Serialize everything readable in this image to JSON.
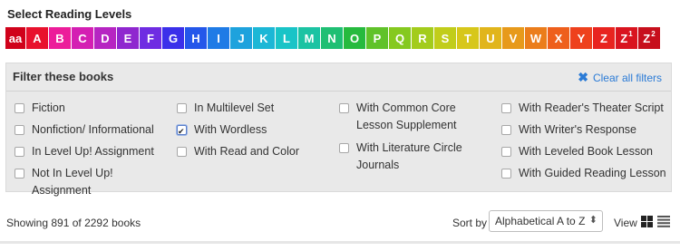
{
  "levels": {
    "title": "Select Reading Levels",
    "items": [
      {
        "label": "aa",
        "color": "#d0021b"
      },
      {
        "label": "A",
        "color": "#e8112d"
      },
      {
        "label": "B",
        "color": "#ec1d9a"
      },
      {
        "label": "C",
        "color": "#d41fb3"
      },
      {
        "label": "D",
        "color": "#b625c2"
      },
      {
        "label": "E",
        "color": "#8f27cf"
      },
      {
        "label": "F",
        "color": "#6f2ce2"
      },
      {
        "label": "G",
        "color": "#3b30ea"
      },
      {
        "label": "H",
        "color": "#2457ea"
      },
      {
        "label": "I",
        "color": "#1f7be6"
      },
      {
        "label": "J",
        "color": "#1ea2dd"
      },
      {
        "label": "K",
        "color": "#1cb7d6"
      },
      {
        "label": "L",
        "color": "#19c4c7"
      },
      {
        "label": "M",
        "color": "#1cc3a3"
      },
      {
        "label": "N",
        "color": "#1fbf73"
      },
      {
        "label": "O",
        "color": "#26ba3e"
      },
      {
        "label": "P",
        "color": "#60c22a"
      },
      {
        "label": "Q",
        "color": "#85c91f"
      },
      {
        "label": "R",
        "color": "#a3cc1c"
      },
      {
        "label": "S",
        "color": "#c1cd1a"
      },
      {
        "label": "T",
        "color": "#d7c71a"
      },
      {
        "label": "U",
        "color": "#e1b51b"
      },
      {
        "label": "V",
        "color": "#e79a1b"
      },
      {
        "label": "W",
        "color": "#eb7d1b"
      },
      {
        "label": "X",
        "color": "#ee5f1c"
      },
      {
        "label": "Y",
        "color": "#ee411d"
      },
      {
        "label": "Z",
        "color": "#e8241f"
      },
      {
        "label": "Z",
        "sup": "1",
        "color": "#d9141f"
      },
      {
        "label": "Z",
        "sup": "2",
        "color": "#c70f1c"
      }
    ]
  },
  "filters": {
    "title": "Filter these books",
    "clear_label": "Clear all filters",
    "options": [
      {
        "label": "Fiction",
        "checked": false
      },
      {
        "label": "Nonfiction/ Informational",
        "checked": false
      },
      {
        "label": "In Level Up! Assignment",
        "checked": false
      },
      {
        "label": "Not In Level Up! Assignment",
        "checked": false
      },
      {
        "label": "In Multilevel Set",
        "checked": false
      },
      {
        "label": "With Wordless",
        "checked": true
      },
      {
        "label": "With Read and Color",
        "checked": false
      },
      {
        "label": "With Common Core Lesson Supplement",
        "checked": false
      },
      {
        "label": "With Literature Circle Journals",
        "checked": false
      },
      {
        "label": "With Reader's Theater Script",
        "checked": false
      },
      {
        "label": "With Writer's Response",
        "checked": false
      },
      {
        "label": "With Leveled Book Lesson",
        "checked": false
      },
      {
        "label": "With Guided Reading Lesson",
        "checked": false
      }
    ]
  },
  "results": {
    "showing_text": "Showing 891 of 2292 books",
    "sort_label": "Sort by",
    "sort_value": "Alphabetical A to Z",
    "view_label": "View",
    "view_mode": "grid"
  }
}
